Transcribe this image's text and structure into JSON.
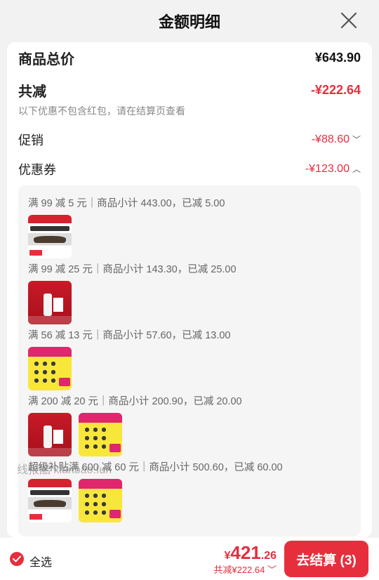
{
  "header": {
    "title": "金额明细"
  },
  "summary": {
    "goods_total_label": "商品总价",
    "goods_total_value": "¥643.90",
    "discount_label": "共减",
    "discount_value": "-¥222.64",
    "note": "以下优惠不包含红包，请在结算页查看",
    "promo_label": "促销",
    "promo_value": "-¥88.60",
    "coupon_label": "优惠券",
    "coupon_value": "-¥123.00"
  },
  "coupon_rules": [
    {
      "text": "满 99 减 5 元｜商品小计 443.00，已减 5.00",
      "products": [
        "sun-hat"
      ]
    },
    {
      "text": "满 99 减 25 元｜商品小计 143.30，已减 25.00",
      "products": [
        "serum"
      ]
    },
    {
      "text": "满 56 减 13 元｜商品小计 57.60，已减 13.00",
      "products": [
        "patch"
      ]
    },
    {
      "text": "满 200 减 20 元｜商品小计 200.90，已减 20.00",
      "products": [
        "serum",
        "patch"
      ]
    },
    {
      "text": "超级补贴满 600 减 60 元｜商品小计 500.60，已减 60.00",
      "products": [
        "sun-hat",
        "patch"
      ]
    }
  ],
  "watermark": "线报酷 xianbao.fun",
  "bottom": {
    "select_all": "全选",
    "total_yen": "¥",
    "total_int": "421",
    "total_dec": ".26",
    "total_saved": "共减¥222.64",
    "checkout": "去结算 (3)"
  },
  "colors": {
    "accent": "#e62e3d"
  }
}
